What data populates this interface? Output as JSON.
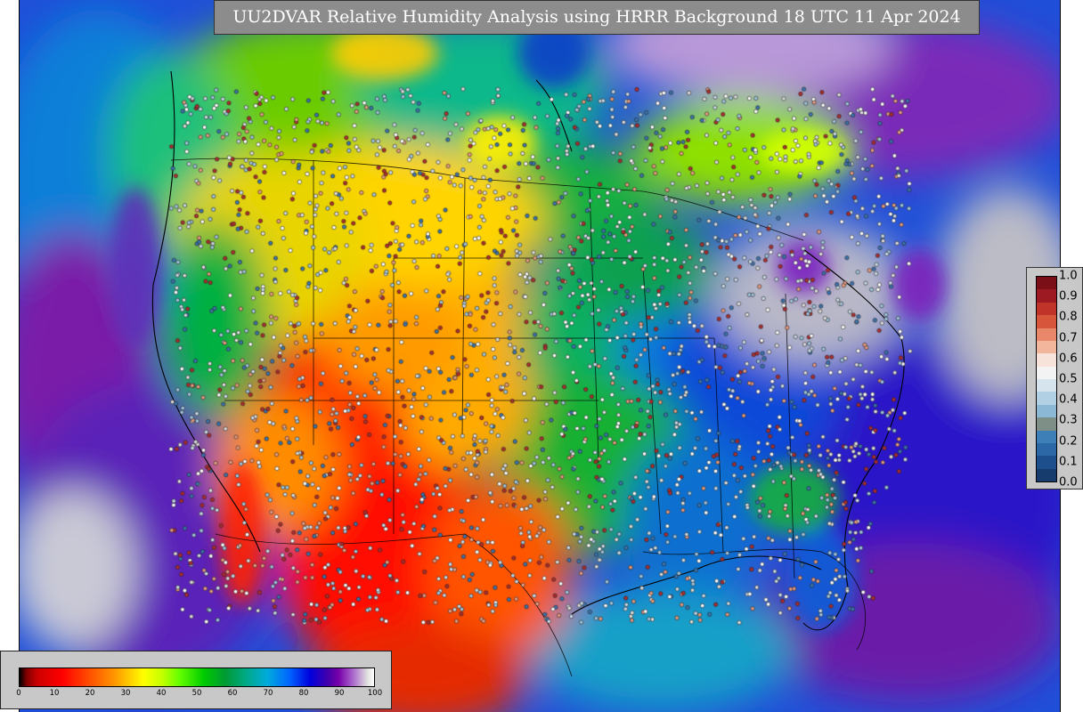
{
  "title": "UU2DVAR Relative Humidity Analysis using HRRR Background 18 UTC 11 Apr 2024",
  "field_colorbar": {
    "ticks": [
      "0",
      "10",
      "20",
      "30",
      "40",
      "50",
      "60",
      "70",
      "80",
      "90",
      "100"
    ]
  },
  "obs_colorbar": {
    "ticks": [
      "1.0",
      "0.9",
      "0.8",
      "0.7",
      "0.6",
      "0.5",
      "0.4",
      "0.3",
      "0.2",
      "0.1",
      "0.0"
    ],
    "colors": [
      "#7a0f17",
      "#9e1a22",
      "#bf3328",
      "#d6553b",
      "#e8876a",
      "#f2b69c",
      "#f7e3d9",
      "#f3f3f3",
      "#d6e4ee",
      "#b2d0e3",
      "#8ab8d5",
      "#7d8f86",
      "#3e7fb8",
      "#2c68a6",
      "#1d4f8c",
      "#163c6e"
    ]
  }
}
